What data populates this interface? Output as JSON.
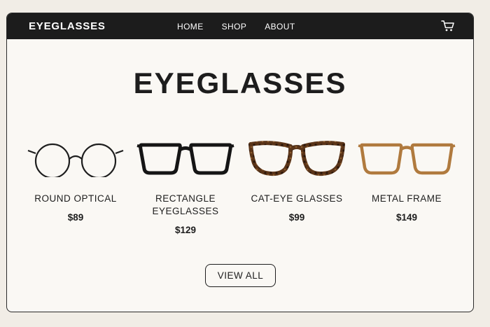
{
  "navbar": {
    "brand": "EYEGLASSES",
    "links": [
      "HOME",
      "SHOP",
      "ABOUT"
    ],
    "cart_icon": "shopping-cart-icon"
  },
  "hero": {
    "title": "EYEGLASSES"
  },
  "products": [
    {
      "name": "ROUND OPTICAL",
      "price": "$89",
      "frame_color": "#1e1e1e",
      "style": "round"
    },
    {
      "name": "RECTANGLE EYEGLASSES",
      "price": "$129",
      "frame_color": "#151515",
      "style": "rectangle"
    },
    {
      "name": "CAT-EYE GLASSES",
      "price": "$99",
      "frame_color": "#5a3418",
      "style": "cat-eye"
    },
    {
      "name": "METAL FRAME",
      "price": "$149",
      "frame_color": "#b07a3e",
      "style": "square"
    }
  ],
  "cta": {
    "label": "VIEW ALL"
  }
}
